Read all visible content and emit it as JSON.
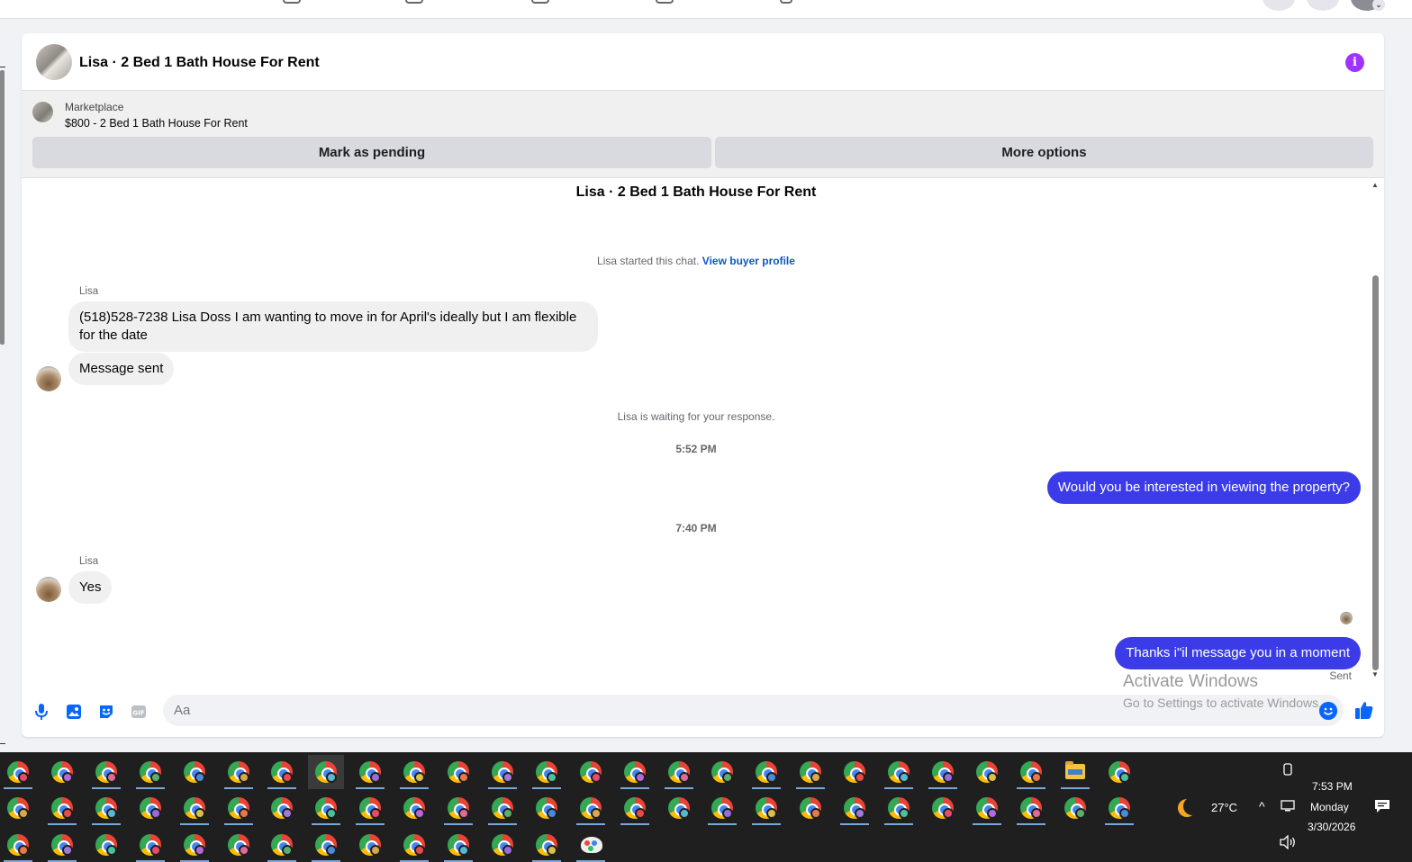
{
  "header": {
    "title": "Lisa · 2 Bed 1 Bath House For Rent"
  },
  "marketplace": {
    "label": "Marketplace",
    "listing": "$800 - 2 Bed 1 Bath House For Rent",
    "mark_pending_label": "Mark as pending",
    "more_options_label": "More options"
  },
  "conversation": {
    "title": "Lisa · 2 Bed 1 Bath House For Rent",
    "started_text": "Lisa started this chat.",
    "view_profile_label": "View buyer profile",
    "waiting_text": "Lisa is waiting for your response.",
    "messages": [
      {
        "sender": "Lisa",
        "text": "(518)528-7238 Lisa Doss I am wanting to move in for April's ideally  but I am flexible for the date"
      },
      {
        "text": "Message sent"
      },
      {
        "time": "5:52 PM"
      },
      {
        "outgoing": true,
        "text": "Would you be interested in viewing the property?"
      },
      {
        "time": "7:40 PM"
      },
      {
        "sender": "Lisa",
        "text": "Yes"
      },
      {
        "outgoing": true,
        "text": "Thanks i\"il message you in a moment",
        "status": "Sent"
      }
    ]
  },
  "composer": {
    "placeholder": "Aa"
  },
  "watermark": {
    "line1": "Activate Windows",
    "line2": "Go to Settings to activate Windows."
  },
  "taskbar": {
    "weather": "27°C",
    "time": "7:53 PM",
    "day": "Monday",
    "date": "3/30/2026"
  },
  "colors": {
    "outgoing_bubble": "#3b3ce8",
    "accent": "#0866ff",
    "info_icon": "#a033ff"
  }
}
